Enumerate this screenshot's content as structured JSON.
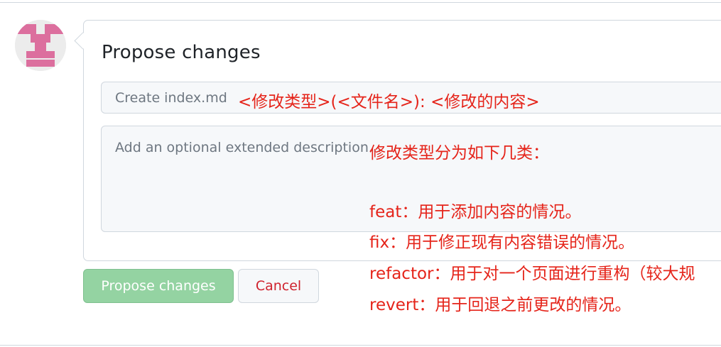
{
  "commit_form": {
    "title": "Propose changes",
    "summary_placeholder": "Create index.md",
    "description_placeholder": "Add an optional extended description..."
  },
  "buttons": {
    "propose_label": "Propose changes",
    "cancel_label": "Cancel"
  },
  "annotations": {
    "format_hint": "<修改类型>(<文件名>): <修改的内容>",
    "types_title": "修改类型分为如下几类：",
    "types": [
      "feat：用于添加内容的情况。",
      "fix：用于修正现有内容错误的情况。",
      "refactor：用于对一个页面进行重构（较大规",
      "revert：用于回退之前更改的情况。"
    ]
  },
  "colors": {
    "annotation": "#e5241a",
    "propose_button_bg": "#94d3a2",
    "cancel_text": "#cf222e",
    "avatar_mark": "#dc6f9e"
  },
  "icons": {
    "avatar": "identicon-avatar"
  }
}
